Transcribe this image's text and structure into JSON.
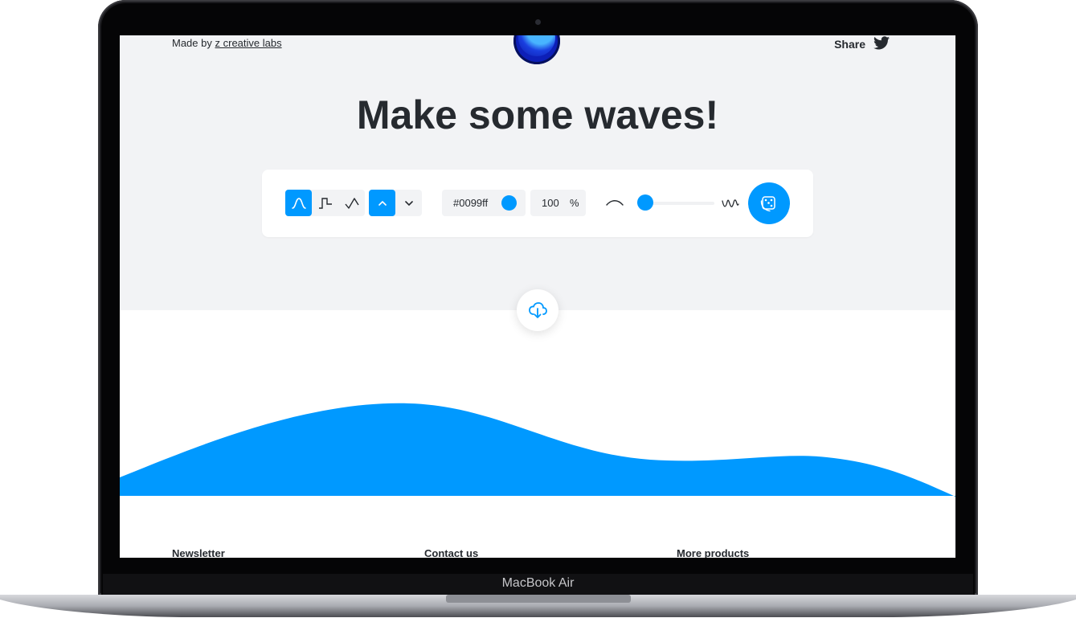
{
  "device": {
    "brand_label": "MacBook Air"
  },
  "header": {
    "made_by_prefix": "Made by",
    "made_by_link": "z creative labs",
    "share_label": "Share",
    "logo_icon": "wave-ball-logo-icon",
    "share_icon": "twitter-icon"
  },
  "hero": {
    "title": "Make some waves!"
  },
  "toolbar": {
    "wave_types": [
      {
        "name": "smooth-wave-icon",
        "selected": true
      },
      {
        "name": "step-wave-icon",
        "selected": false
      },
      {
        "name": "peak-wave-icon",
        "selected": false
      }
    ],
    "direction": [
      {
        "name": "chevron-up-icon",
        "selected": true
      },
      {
        "name": "chevron-down-icon",
        "selected": false
      }
    ],
    "color_value": "#0099ff",
    "opacity_value": "100",
    "opacity_unit": "%",
    "complexity_level": 0.0,
    "randomize_icon": "dice-icon"
  },
  "wave": {
    "fill_color": "#0099ff",
    "download_icon": "cloud-download-icon"
  },
  "footer": {
    "columns": [
      "Newsletter",
      "Contact us",
      "More products"
    ]
  },
  "colors": {
    "accent": "#0099ff",
    "text": "#262a2f",
    "background": "#f2f3f5"
  }
}
